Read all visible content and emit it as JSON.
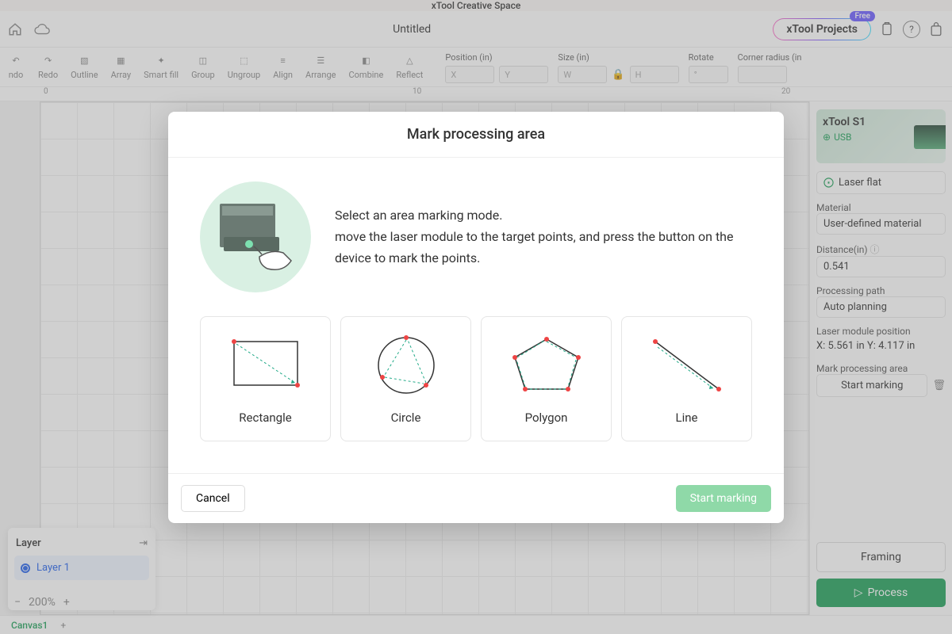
{
  "app": {
    "title": "xTool Creative Space"
  },
  "document": {
    "title": "Untitled"
  },
  "header": {
    "projects_button": "xTool Projects",
    "free_badge": "Free"
  },
  "toolbar": {
    "undo": "ndo",
    "redo": "Redo",
    "outline": "Outline",
    "array": "Array",
    "smart_fill": "Smart fill",
    "group": "Group",
    "ungroup": "Ungroup",
    "align": "Align",
    "arrange": "Arrange",
    "combine": "Combine",
    "reflect": "Reflect"
  },
  "properties": {
    "position_label": "Position (in)",
    "position_x_ph": "X",
    "position_y_ph": "Y",
    "size_label": "Size (in)",
    "size_w_ph": "W",
    "size_h_ph": "H",
    "rotate_label": "Rotate",
    "rotate_ph": "°",
    "corner_label": "Corner radius (in"
  },
  "ruler": {
    "t0": "0",
    "t10": "10",
    "t20": "20"
  },
  "sidebar": {
    "device_name": "xTool S1",
    "connection": "USB",
    "mode_label": "Laser flat",
    "material_label": "Material",
    "material_value": "User-defined material",
    "distance_label": "Distance(in)",
    "distance_value": "0.541",
    "path_label": "Processing path",
    "path_value": "Auto planning",
    "laser_pos_label": "Laser module position",
    "laser_pos_value": "X: 5.561 in   Y: 4.117 in",
    "mark_area_label": "Mark processing area",
    "start_marking": "Start marking",
    "framing": "Framing",
    "process": "Process"
  },
  "layers": {
    "header": "Layer",
    "item1": "Layer 1"
  },
  "zoom": {
    "value": "200%"
  },
  "bottom": {
    "canvas_tab": "Canvas1"
  },
  "modal": {
    "title": "Mark processing area",
    "instruction1": "Select an area marking mode.",
    "instruction2": "move the laser module to the target points, and press the button on the device to mark the points.",
    "modes": {
      "rectangle": "Rectangle",
      "circle": "Circle",
      "polygon": "Polygon",
      "line": "Line"
    },
    "cancel": "Cancel",
    "start": "Start marking"
  }
}
